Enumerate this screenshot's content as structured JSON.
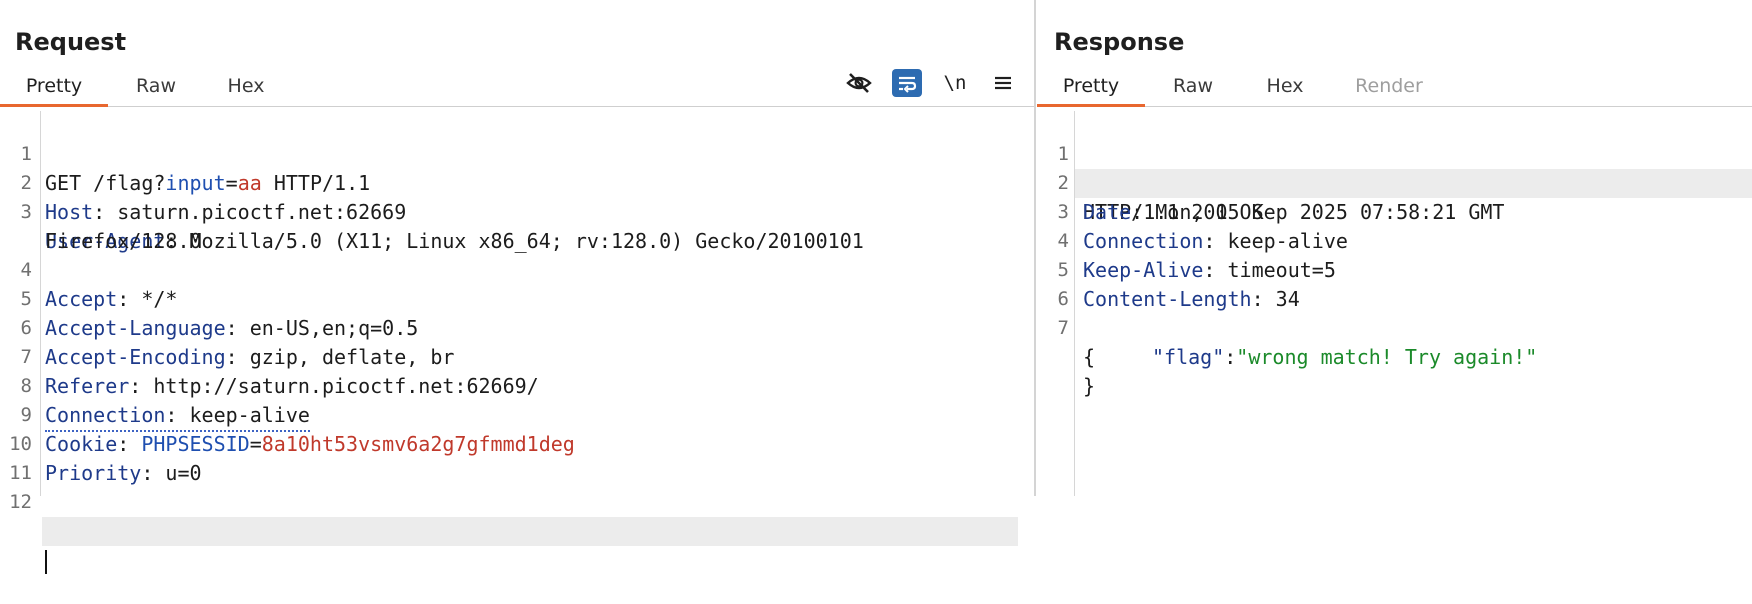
{
  "request": {
    "title": "Request",
    "tabs": [
      "Pretty",
      "Raw",
      "Hex"
    ],
    "active_tab": "Pretty",
    "toolbar": {
      "icons": [
        "hide-eye-icon",
        "wrap-lines-icon",
        "newline-icon",
        "menu-icon"
      ],
      "newline_label": "\\n"
    },
    "lines": [
      {
        "n": "1",
        "method": "GET",
        "path": " /flag?",
        "param_name": "input",
        "eq": "=",
        "param_value": "aa",
        "proto": " HTTP/1.1"
      },
      {
        "n": "2",
        "key": "Host",
        "value": " saturn.picoctf.net:62669"
      },
      {
        "n": "3",
        "key": "User-Agent",
        "value": " Mozilla/5.0 (X11; Linux x86_64; rv:128.0) Gecko/20100101",
        "cont": "Firefox/128.0"
      },
      {
        "n": "4",
        "key": "Accept",
        "value": " */*"
      },
      {
        "n": "5",
        "key": "Accept-Language",
        "value": " en-US,en;q=0.5"
      },
      {
        "n": "6",
        "key": "Accept-Encoding",
        "value": " gzip, deflate, br"
      },
      {
        "n": "7",
        "key": "Referer",
        "value": " http://saturn.picoctf.net:62669/"
      },
      {
        "n": "8",
        "key": "Connection",
        "value": " keep-alive"
      },
      {
        "n": "9",
        "key": "Cookie",
        "cookie_name": "PHPSESSID",
        "cookie_value": "8a10ht53vsmv6a2g7gfmmd1deg"
      },
      {
        "n": "10",
        "key": "Priority",
        "value": " u=0"
      },
      {
        "n": "11"
      },
      {
        "n": "12"
      }
    ]
  },
  "response": {
    "title": "Response",
    "tabs": [
      "Pretty",
      "Raw",
      "Hex",
      "Render"
    ],
    "active_tab": "Pretty",
    "lines": [
      {
        "n": "1",
        "status": "HTTP/1.1 200 OK"
      },
      {
        "n": "2",
        "key": "Date",
        "value": " Mon, 15 Sep 2025 07:58:21 GMT"
      },
      {
        "n": "3",
        "key": "Connection",
        "value": " keep-alive"
      },
      {
        "n": "4",
        "key": "Keep-Alive",
        "value": " timeout=5"
      },
      {
        "n": "5",
        "key": "Content-Length",
        "value": " 34"
      },
      {
        "n": "6"
      },
      {
        "n": "7",
        "brace_open": "{"
      }
    ],
    "json_key": "\"flag\"",
    "json_colon": ":",
    "json_value": "\"wrong match! Try again!\"",
    "brace_close": "}"
  }
}
